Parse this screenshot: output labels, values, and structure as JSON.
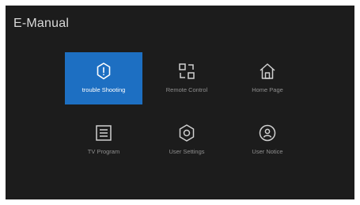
{
  "header": {
    "title": "E-Manual"
  },
  "menu": {
    "items": [
      {
        "label": "trouble Shooting",
        "icon": "alert-circle-icon",
        "selected": true
      },
      {
        "label": "Remote Control",
        "icon": "remote-control-icon",
        "selected": false
      },
      {
        "label": "Home Page",
        "icon": "home-icon",
        "selected": false
      },
      {
        "label": "TV Program",
        "icon": "tv-program-icon",
        "selected": false
      },
      {
        "label": "User Settings",
        "icon": "settings-hexagon-icon",
        "selected": false
      },
      {
        "label": "User Notice",
        "icon": "user-notice-icon",
        "selected": false
      }
    ]
  },
  "colors": {
    "background": "#1c1c1c",
    "selected": "#1d6fc2",
    "icon": "#d0d0d0",
    "label": "#8f8f8f"
  }
}
